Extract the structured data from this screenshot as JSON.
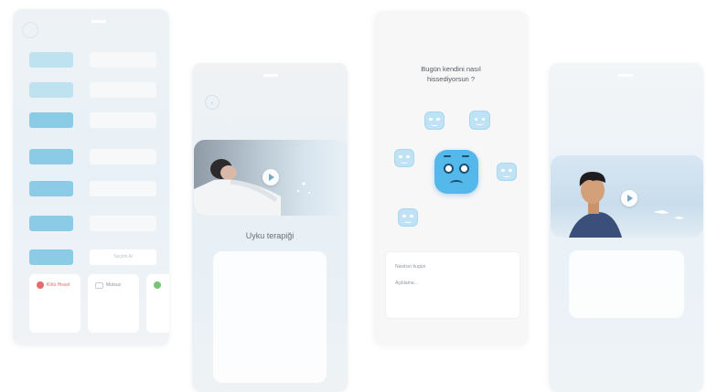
{
  "phone1": {
    "rows": [
      {
        "button": "",
        "field": ""
      },
      {
        "button": "",
        "field": ""
      },
      {
        "button": "",
        "field": ""
      },
      {
        "button": "",
        "field": ""
      },
      {
        "button": "",
        "field": ""
      },
      {
        "button": "",
        "field": ""
      },
      {
        "button": "",
        "field": "Seçimi Al"
      }
    ],
    "cards": [
      {
        "label": "Kötü Hisset",
        "icon": "heart-icon",
        "color": "#e86b6b"
      },
      {
        "label": "Mutsuz",
        "icon": "mail-icon",
        "color": "#c9ccd2"
      },
      {
        "label": "",
        "icon": "leaf-icon",
        "color": "#79c27a"
      }
    ]
  },
  "phone2": {
    "back_icon": "back-arrow-icon",
    "title": "Uyku terapiği"
  },
  "phone3": {
    "question": "Bugün kendini nasıl\nhissediyorsun ?",
    "sheet_lines": [
      "Nasılsın bugün",
      "Açıklama..."
    ]
  },
  "phone4": {
    "play_icon": "play-icon"
  },
  "colors": {
    "accent": "#55b8ea",
    "accent_light": "#bfe3f5",
    "button": "#8ccbe6"
  }
}
